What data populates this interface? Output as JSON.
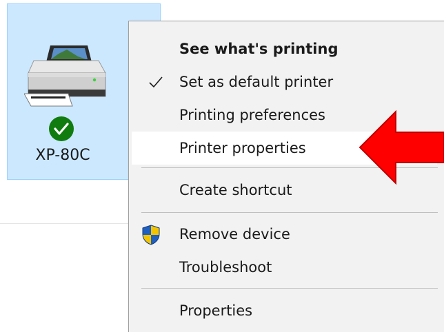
{
  "device": {
    "name": "XP-80C",
    "icon": "printer-icon",
    "badge_icon": "check-circle-icon",
    "badge_color": "#107c10",
    "selected_bg": "#cce8ff"
  },
  "context_menu": {
    "items": [
      {
        "label": "See what's printing",
        "bold": true,
        "icon": ""
      },
      {
        "label": "Set as default printer",
        "bold": false,
        "icon": "checkmark-icon"
      },
      {
        "label": "Printing preferences",
        "bold": false,
        "icon": ""
      },
      {
        "label": "Printer properties",
        "bold": false,
        "icon": "",
        "highlighted": true
      },
      {
        "label": "Create shortcut",
        "bold": false,
        "icon": ""
      },
      {
        "label": "Remove device",
        "bold": false,
        "icon": "uac-shield-icon"
      },
      {
        "label": "Troubleshoot",
        "bold": false,
        "icon": ""
      },
      {
        "label": "Properties",
        "bold": false,
        "icon": ""
      }
    ]
  },
  "annotation": {
    "icon": "red-arrow-icon",
    "color": "#ff0000",
    "points_to": "Printer properties"
  }
}
